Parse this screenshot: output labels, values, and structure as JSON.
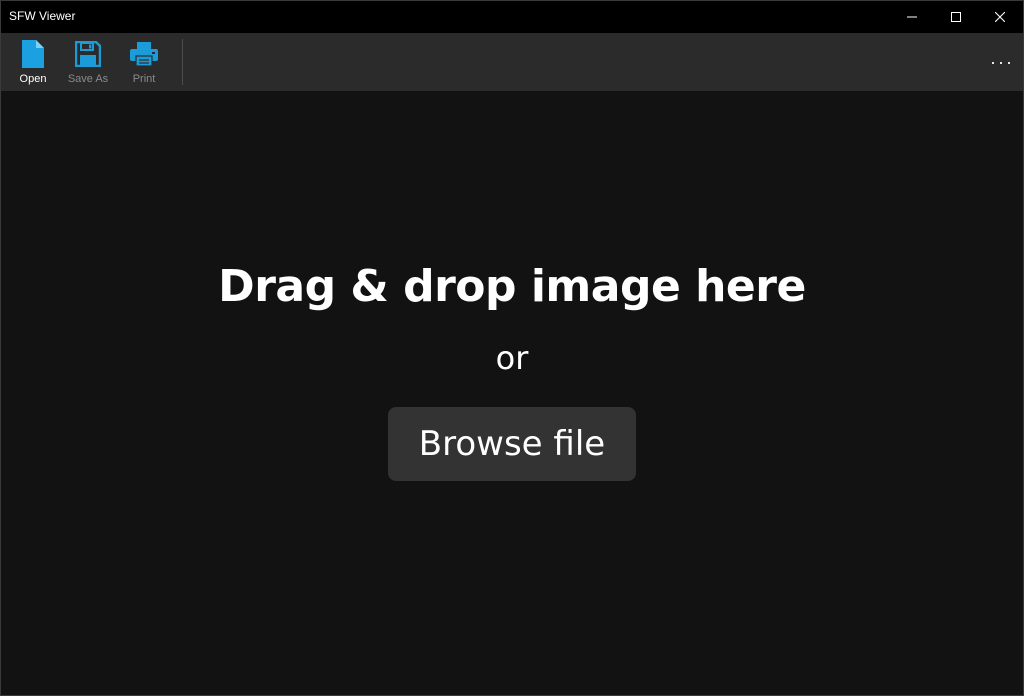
{
  "window": {
    "title": "SFW Viewer"
  },
  "caption_buttons": {
    "minimize_icon": "minimize-icon",
    "maximize_icon": "maximize-icon",
    "close_icon": "close-icon"
  },
  "toolbar": {
    "open": {
      "label": "Open",
      "icon": "document-icon",
      "enabled": true
    },
    "save_as": {
      "label": "Save As",
      "icon": "save-icon",
      "enabled": false
    },
    "print": {
      "label": "Print",
      "icon": "printer-icon",
      "enabled": false
    },
    "more_label": "···"
  },
  "content": {
    "drop_title": "Drag & drop image here",
    "or_text": "or",
    "browse_label": "Browse file"
  },
  "colors": {
    "accent": "#1ba1e2",
    "background": "#121212",
    "titlebar": "#000000",
    "commandbar": "#2b2b2b",
    "button": "#333333"
  }
}
